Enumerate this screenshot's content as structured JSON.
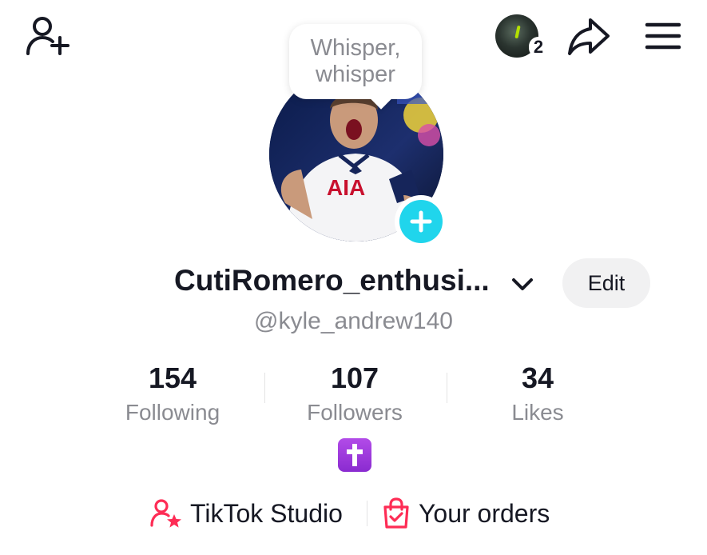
{
  "bubble": {
    "text": "Whisper, whisper"
  },
  "profile": {
    "display_name": "CutiRomero_enthusi...",
    "handle": "@kyle_andrew140",
    "edit_label": "Edit",
    "account_badge_count": "2",
    "bio_emoji": "✝️"
  },
  "stats": [
    {
      "value": "154",
      "label": "Following"
    },
    {
      "value": "107",
      "label": "Followers"
    },
    {
      "value": "34",
      "label": "Likes"
    }
  ],
  "links": {
    "studio": "TikTok Studio",
    "orders": "Your orders"
  },
  "avatar_jersey_text": "AIA",
  "icons": [
    "add-friend-icon",
    "share-icon",
    "hamburger-menu-icon",
    "chevron-down-icon",
    "plus-icon",
    "creator-star-icon",
    "shopping-bag-icon"
  ],
  "colors": {
    "accent_cyan": "#20d5ec",
    "brand_pink": "#fe2c55",
    "text_primary": "#161823",
    "text_secondary": "#8a8b91"
  }
}
